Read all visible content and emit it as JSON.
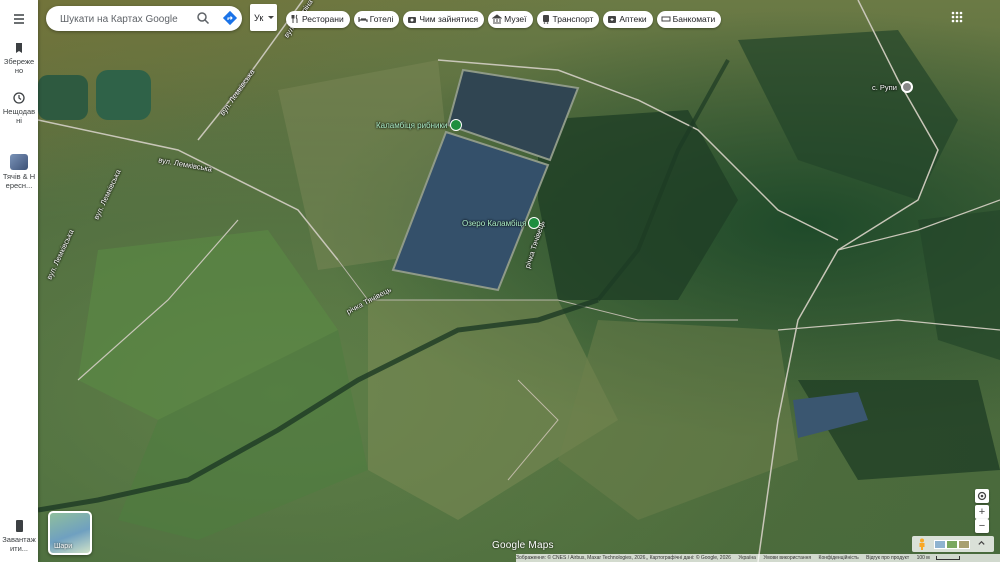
{
  "rail": {
    "menu_icon": "hamburger-menu-icon",
    "saved_label": "Збережено",
    "recent_label": "Нещодавні",
    "places_label": "Тячів & Нересн...",
    "download_label": "Завантажити..."
  },
  "search": {
    "placeholder": "Шукати на Картах Google",
    "search_icon": "search-icon",
    "directions_icon": "directions-icon"
  },
  "lang_button": "Ук",
  "chips": [
    {
      "icon": "restaurant-icon",
      "label": "Ресторани"
    },
    {
      "icon": "hotel-icon",
      "label": "Готелі"
    },
    {
      "icon": "camera-icon",
      "label": "Чим зайнятися"
    },
    {
      "icon": "museum-icon",
      "label": "Музеї"
    },
    {
      "icon": "transit-icon",
      "label": "Транспорт"
    },
    {
      "icon": "pharmacy-icon",
      "label": "Аптеки"
    },
    {
      "icon": "atm-icon",
      "label": "Банкомати"
    }
  ],
  "map_labels": {
    "street_1": "вул. Лемківська",
    "street_2": "вул. Лемківська",
    "street_3": "вул. Лемківська",
    "street_4": "вул. Лемківська",
    "street_5": "вул. Лемківська",
    "river_1": "річка Тячівець",
    "river_2": "річка Тячівець",
    "village": "с. Рупи",
    "top_street": "вул. Гагаріна"
  },
  "pois": [
    {
      "label": "Каламбіця рибники",
      "icon": "fishing-poi-icon"
    },
    {
      "label": "Озеро Каламбіця",
      "icon": "lake-poi-icon"
    }
  ],
  "layers_label": "Шари",
  "google_logo": "Google Maps",
  "footer": {
    "imagery": "Зображення: © CNES / Airbus, Maxar Technologies, 2026,, Картографічні дані: © Google, 2026",
    "region": "Україна",
    "terms": "Умови використання",
    "privacy": "Конфіденційність",
    "feedback": "Відгук про продукт",
    "scale": "100 м"
  },
  "controls": {
    "locate_icon": "my-location-icon",
    "zoom_in": "+",
    "zoom_out": "−",
    "expand_icon": "chevron-up-icon",
    "pegman_icon": "pegman-icon"
  }
}
